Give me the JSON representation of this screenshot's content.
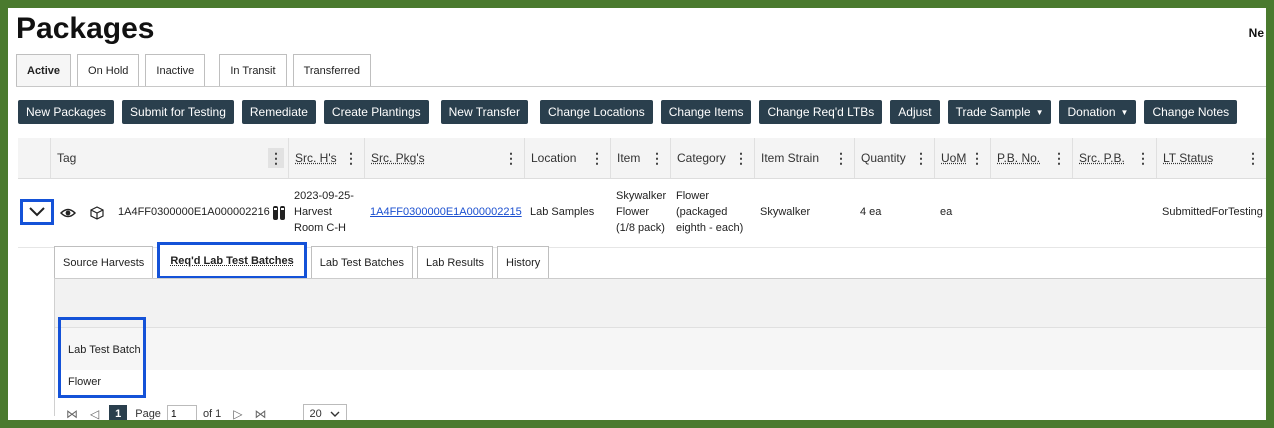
{
  "title": "Packages",
  "corner_text": "Ne",
  "tabs": [
    {
      "label": "Active",
      "active": true
    },
    {
      "label": "On Hold",
      "active": false
    },
    {
      "label": "Inactive",
      "active": false
    },
    {
      "label": "In Transit",
      "active": false
    },
    {
      "label": "Transferred",
      "active": false
    }
  ],
  "toolbar": {
    "new_packages": "New Packages",
    "submit_for_testing": "Submit for Testing",
    "remediate": "Remediate",
    "create_plantings": "Create Plantings",
    "new_transfer": "New Transfer",
    "change_locations": "Change Locations",
    "change_items": "Change Items",
    "change_reqd_ltbs": "Change Req'd LTBs",
    "adjust": "Adjust",
    "trade_sample": "Trade Sample",
    "donation": "Donation",
    "change_notes": "Change Notes"
  },
  "columns": {
    "tag": "Tag",
    "src_hs": "Src. H's",
    "src_pkgs": "Src. Pkg's",
    "location": "Location",
    "item": "Item",
    "category": "Category",
    "item_strain": "Item Strain",
    "quantity": "Quantity",
    "uom": "UoM",
    "pb_no": "P.B. No.",
    "src_pb": "Src. P.B.",
    "lt_status": "LT Status"
  },
  "row": {
    "tag": "1A4FF0300000E1A000002216",
    "src_hs": "2023-09-25-Harvest Room C-H",
    "src_pkgs": "1A4FF0300000E1A000002215",
    "location": "Lab Samples",
    "item": "Skywalker Flower (1/8 pack)",
    "category": "Flower (packaged eighth - each)",
    "item_strain": "Skywalker",
    "quantity": "4 ea",
    "uom": "ea",
    "pb_no": "",
    "src_pb": "",
    "lt_status": "SubmittedForTesting"
  },
  "subtabs": [
    {
      "label": "Source Harvests",
      "active": false
    },
    {
      "label": "Req'd Lab Test Batches",
      "active": true
    },
    {
      "label": "Lab Test Batches",
      "active": false
    },
    {
      "label": "Lab Results",
      "active": false
    },
    {
      "label": "History",
      "active": false
    }
  ],
  "subgrid": {
    "header": "Lab Test Batch",
    "value": "Flower"
  },
  "pager": {
    "current_page": "1",
    "page_label": "Page",
    "page_input": "1",
    "of_label": "of 1",
    "page_size": "20"
  },
  "colors": {
    "accent": "#1452d8",
    "button_bg": "#2a3f4d",
    "frame_bg": "#4a7a2e"
  }
}
